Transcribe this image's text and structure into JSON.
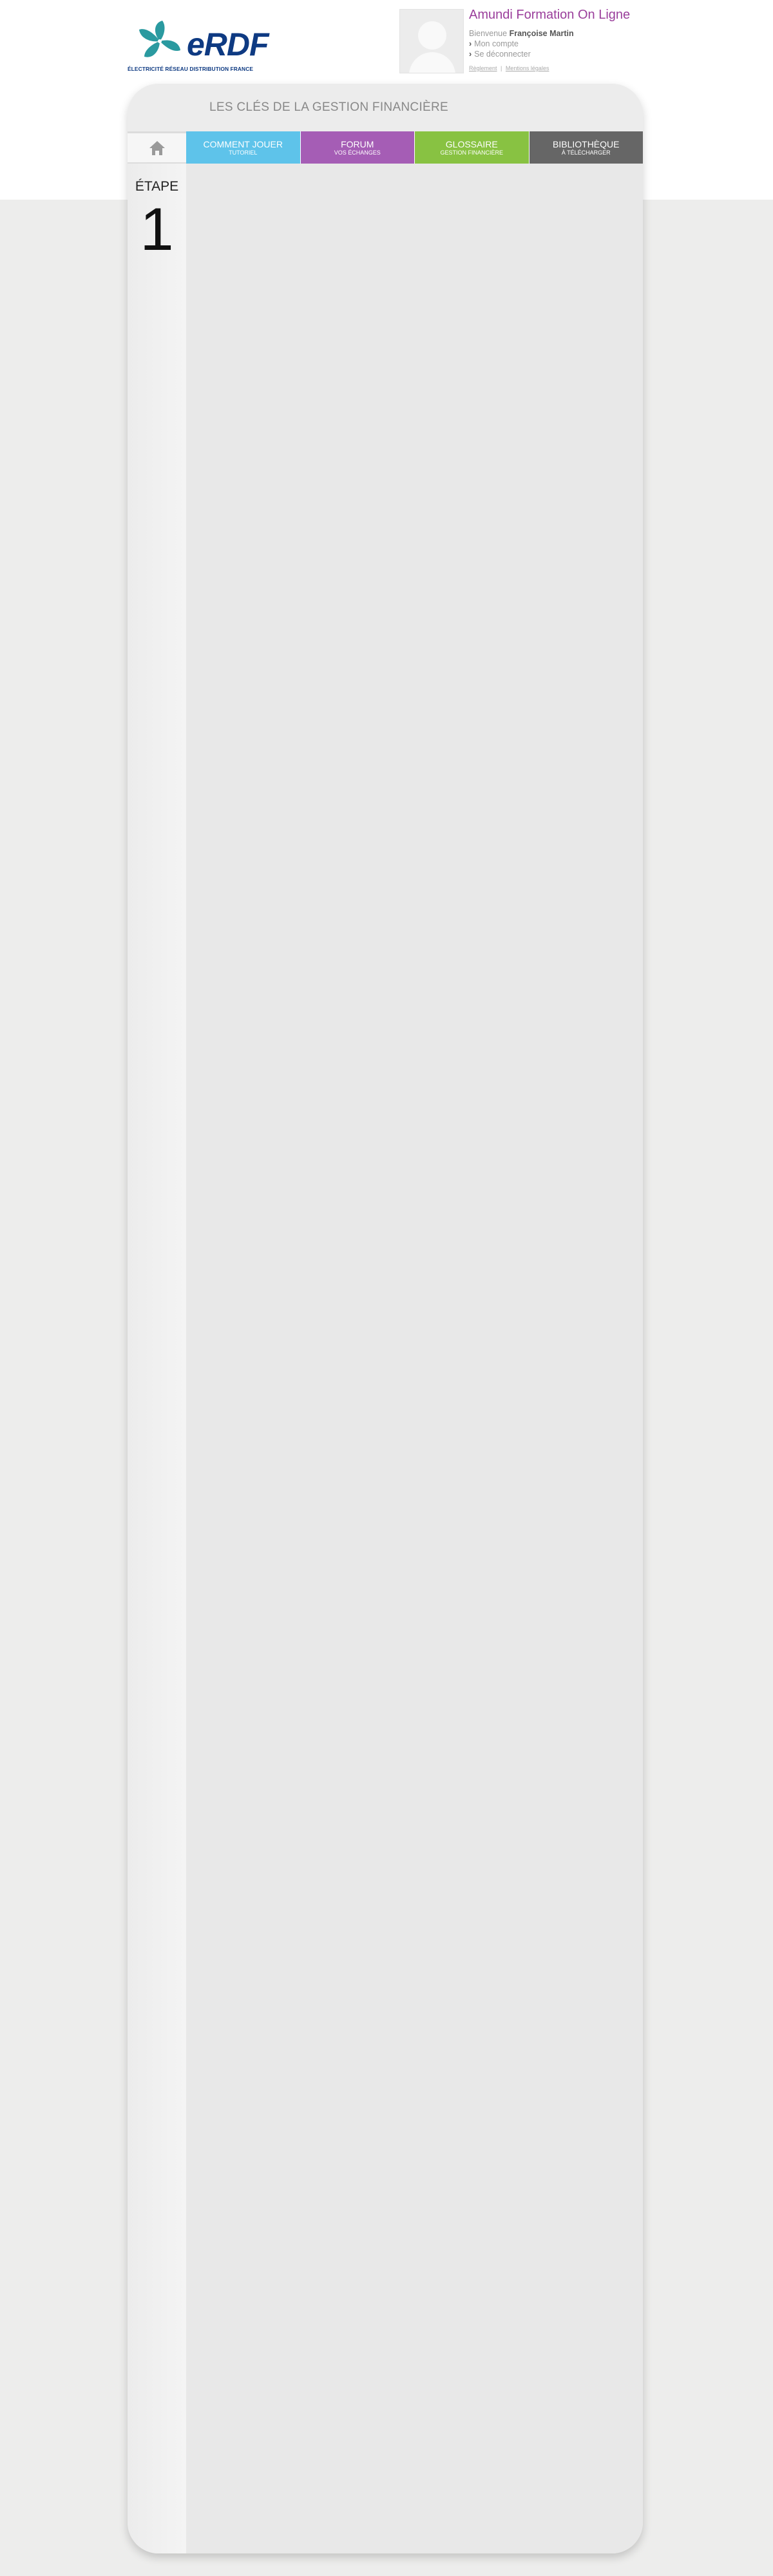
{
  "colors": {
    "background": "#ededec",
    "logo_blue": "#0e3a82",
    "logo_teal": "#2a9aa0",
    "title_purple": "#9a3e9b",
    "nav_blue": "#5ec3ea",
    "nav_purple": "#a55db5",
    "nav_green": "#88c242",
    "nav_grey": "#666666"
  },
  "header": {
    "logo": {
      "word": "eRDF",
      "tagline": "ÉLECTRICITÉ RÉSEAU DISTRIBUTION FRANCE"
    },
    "app_title": "Amundi Formation On Ligne",
    "welcome_prefix": "Bienvenue",
    "user_name": "Françoise Martin",
    "links": [
      {
        "icon": "chevron-right-icon",
        "label": "Mon compte"
      },
      {
        "icon": "chevron-right-icon",
        "label": "Se déconnecter"
      }
    ],
    "legal": {
      "reglement": "Règlement",
      "separator": "|",
      "mentions": "Mentions légales"
    }
  },
  "card": {
    "title": "LES CLÉS DE LA GESTION FINANCIÈRE",
    "nav": {
      "home_icon": "home-icon",
      "items": [
        {
          "label": "COMMENT JOUER",
          "sub": "TUTORIEL"
        },
        {
          "label": "FORUM",
          "sub": "VOS ÉCHANGES"
        },
        {
          "label": "GLOSSAIRE",
          "sub": "GESTION FINANCIÈRE"
        },
        {
          "label": "BIBLIOTHÈQUE",
          "sub": "À TÉLÉCHARGER"
        }
      ]
    },
    "sidebar": {
      "etape_label": "ÉTAPE",
      "etape_number": "1"
    }
  }
}
